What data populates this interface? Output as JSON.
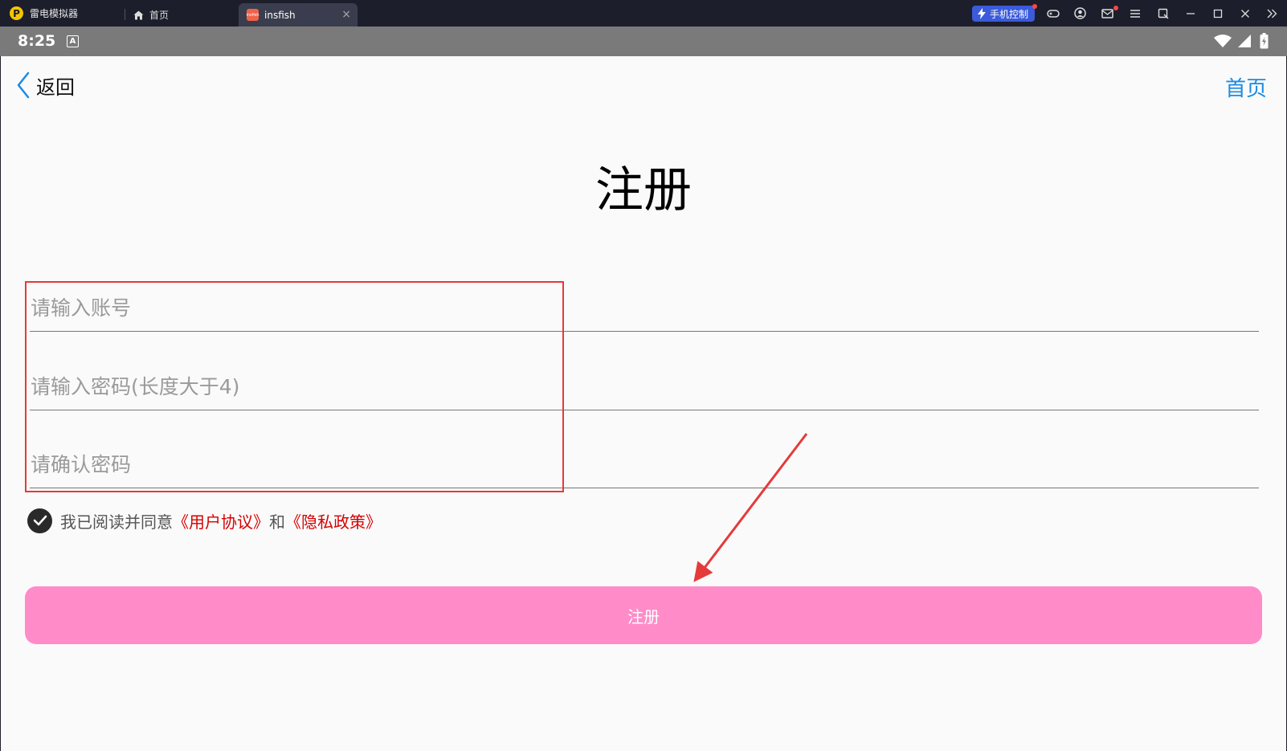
{
  "emulator": {
    "app_name": "雷电模拟器",
    "brand_glyph": "P",
    "tabs": [
      {
        "label": "首页",
        "icon": "house-icon"
      },
      {
        "label": "insfish",
        "icon": "insfish-favicon",
        "favicon_text": "insfish",
        "close": "×"
      }
    ],
    "phone_control_label": "手机控制",
    "toolbar_icons": [
      "gamepad-icon",
      "user-icon",
      "mail-icon",
      "menu-icon",
      "screen-rotate-icon",
      "minimize-icon",
      "maximize-icon",
      "close-icon",
      "expand-sidebar-icon"
    ]
  },
  "statusbar": {
    "time": "8:25",
    "notification_letter": "A"
  },
  "nav": {
    "back_label": "返回",
    "home_label": "首页"
  },
  "page": {
    "title": "注册",
    "fields": {
      "account_placeholder": "请输入账号",
      "password_placeholder": "请输入密码(长度大于4)",
      "confirm_placeholder": "请确认密码"
    },
    "agreement": {
      "checked": true,
      "prefix": "我已阅读并同意",
      "user_agreement": "《用户协议》",
      "and": "和",
      "privacy_policy": "《隐私政策》"
    },
    "submit_label": "注册"
  },
  "colors": {
    "accent_link": "#1a8ce3",
    "button": "#ff8cc8",
    "agreement_link": "#d60000",
    "annotation": "#e53a3a"
  }
}
